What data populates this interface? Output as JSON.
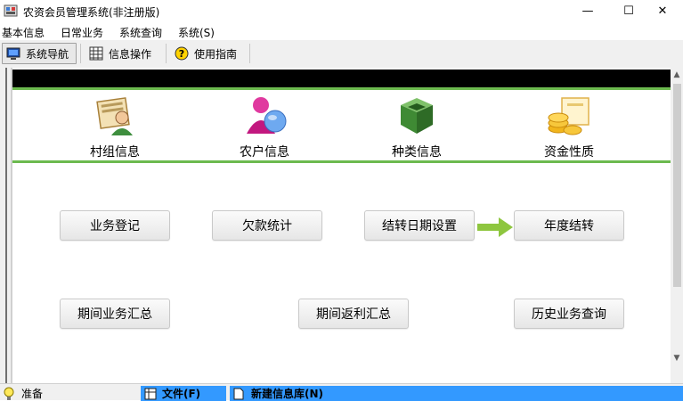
{
  "window": {
    "title": "农资会员管理系统(非注册版)",
    "controls": {
      "minimize": "—",
      "maximize": "☐",
      "close": "✕"
    }
  },
  "menubar": {
    "items": [
      "基本信息",
      "日常业务",
      "系统查询",
      "系统(S)"
    ]
  },
  "toolbar": {
    "items": [
      {
        "label": "系统导航",
        "icon": "monitor-icon",
        "active": true
      },
      {
        "label": "信息操作",
        "icon": "grid-icon",
        "active": false
      },
      {
        "label": "使用指南",
        "icon": "help-icon",
        "active": false
      }
    ]
  },
  "nav_icons": [
    {
      "label": "村组信息",
      "icon": "village-group-icon"
    },
    {
      "label": "农户信息",
      "icon": "farmer-icon"
    },
    {
      "label": "种类信息",
      "icon": "category-box-icon"
    },
    {
      "label": "资金性质",
      "icon": "funds-icon"
    }
  ],
  "buttons": {
    "row1": [
      "业务登记",
      "欠款统计",
      "结转日期设置",
      "年度结转"
    ],
    "row2": [
      "期间业务汇总",
      "期间返利汇总",
      "历史业务查询"
    ]
  },
  "statusbar": {
    "status": "准备",
    "file_menu": "文件(F)",
    "new_db": "新建信息库(N)"
  },
  "colors": {
    "accent_green": "#6cba4f",
    "status_blue": "#3399ff",
    "header_black": "#000000"
  }
}
